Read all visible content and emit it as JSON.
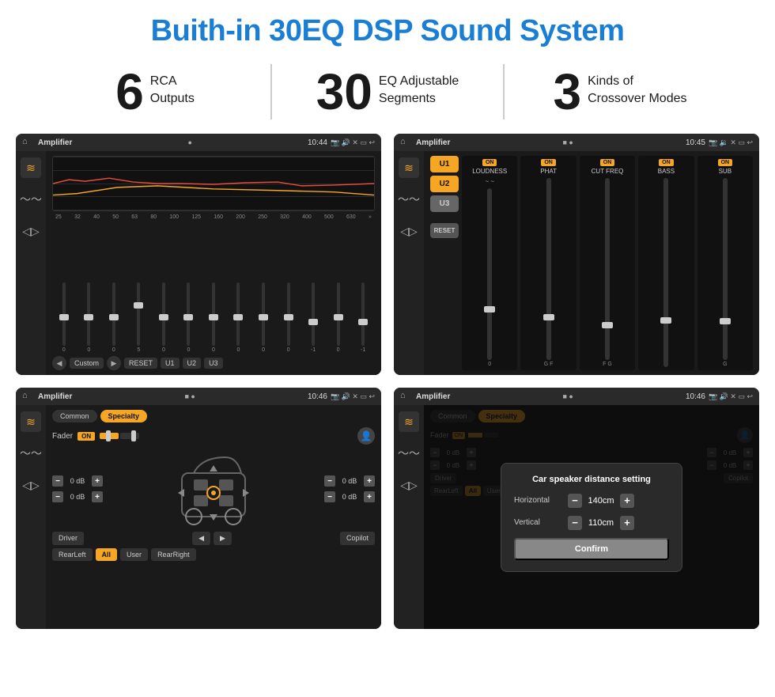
{
  "title": "Buith-in 30EQ DSP Sound System",
  "stats": [
    {
      "number": "6",
      "text": "RCA\nOutputs"
    },
    {
      "number": "30",
      "text": "EQ Adjustable\nSegments"
    },
    {
      "number": "3",
      "text": "Kinds of\nCrossover Modes"
    }
  ],
  "screens": [
    {
      "id": "screen1",
      "topbar": {
        "time": "10:44",
        "title": "Amplifier"
      },
      "type": "eq",
      "freqs": [
        "25",
        "32",
        "40",
        "50",
        "63",
        "80",
        "100",
        "125",
        "160",
        "200",
        "250",
        "320",
        "400",
        "500",
        "630"
      ],
      "values": [
        "0",
        "0",
        "0",
        "5",
        "0",
        "0",
        "0",
        "0",
        "0",
        "0",
        "-1",
        "0",
        "-1"
      ],
      "bottomBtns": [
        "Custom",
        "RESET",
        "U1",
        "U2",
        "U3"
      ]
    },
    {
      "id": "screen2",
      "topbar": {
        "time": "10:45",
        "title": "Amplifier"
      },
      "type": "amp2",
      "presets": [
        "U1",
        "U2",
        "U3"
      ],
      "channels": [
        {
          "label": "LOUDNESS",
          "on": true
        },
        {
          "label": "PHAT",
          "on": true
        },
        {
          "label": "CUT FREQ",
          "on": true
        },
        {
          "label": "BASS",
          "on": true
        },
        {
          "label": "SUB",
          "on": true
        }
      ]
    },
    {
      "id": "screen3",
      "topbar": {
        "time": "10:46",
        "title": "Amplifier"
      },
      "type": "fader",
      "tabs": [
        "Common",
        "Specialty"
      ],
      "activeTab": "Specialty",
      "faderLabel": "Fader",
      "faderOn": true,
      "speakerRows": [
        {
          "db": "0 dB",
          "db2": "0 dB"
        },
        {
          "db": "0 dB",
          "db2": "0 dB"
        }
      ],
      "bottomBtns": [
        "Driver",
        "",
        "Copilot",
        "RearLeft",
        "All",
        "User",
        "RearRight"
      ]
    },
    {
      "id": "screen4",
      "topbar": {
        "time": "10:46",
        "title": "Amplifier"
      },
      "type": "fader-dialog",
      "tabs": [
        "Common",
        "Specialty"
      ],
      "activeTab": "Specialty",
      "dialog": {
        "title": "Car speaker distance setting",
        "rows": [
          {
            "label": "Horizontal",
            "value": "140cm"
          },
          {
            "label": "Vertical",
            "value": "110cm"
          }
        ],
        "confirmLabel": "Confirm"
      },
      "speakerRows": [
        {
          "db": "0 dB"
        },
        {
          "db": "0 dB"
        }
      ],
      "bottomBtns": [
        "Driver",
        "",
        "Copilot",
        "RearLeft",
        "All",
        "User",
        "RearRight"
      ]
    }
  ],
  "icons": {
    "home": "⌂",
    "play": "▶",
    "pause": "⏸",
    "settings": "⚙",
    "back": "↩",
    "eq": "≋",
    "wave": "〜",
    "volume": "♪",
    "expand": "⛶",
    "person": "👤",
    "location": "📍",
    "camera": "📷",
    "speaker": "🔊",
    "left": "◀",
    "right": "▶",
    "plus": "+",
    "minus": "−"
  }
}
